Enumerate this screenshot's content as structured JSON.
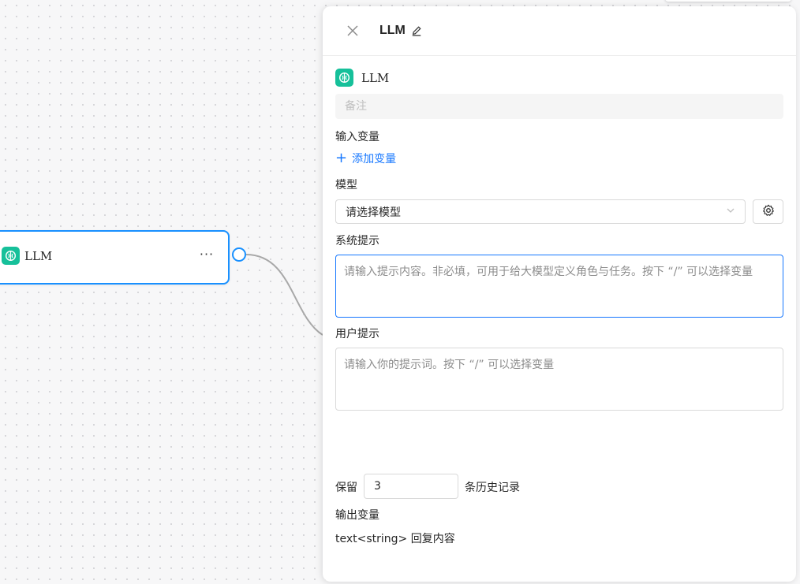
{
  "canvas": {
    "node": {
      "title": "LLM",
      "more_label": "···"
    }
  },
  "panel": {
    "title": "LLM",
    "node_name": "LLM",
    "remark_placeholder": "备注",
    "input_vars_label": "输入变量",
    "add_var_label": "添加变量",
    "model_label": "模型",
    "model_placeholder": "请选择模型",
    "system_prompt_label": "系统提示",
    "system_prompt_placeholder": "请输入提示内容。非必填，可用于给大模型定义角色与任务。按下 “/” 可以选择变量",
    "user_prompt_label": "用户提示",
    "user_prompt_placeholder": "请输入你的提示词。按下 “/” 可以选择变量",
    "history_prefix": "保留",
    "history_value": "3",
    "history_suffix": "条历史记录",
    "output_vars_label": "输出变量",
    "output_var": "text<string> 回复内容"
  },
  "colors": {
    "accent": "#1677ff",
    "node_icon": "#16c09a"
  },
  "icons": [
    "llm-brain-icon",
    "close-icon",
    "edit-icon",
    "plus-icon",
    "chevron-down-icon",
    "gear-icon",
    "more-icon"
  ]
}
